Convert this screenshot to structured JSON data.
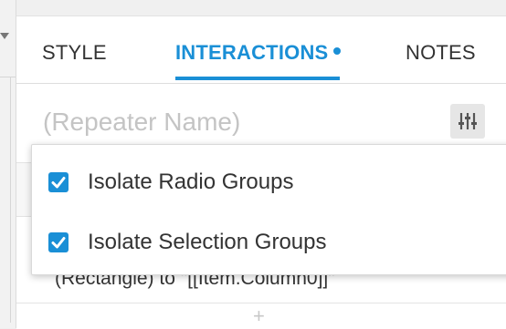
{
  "tabs": [
    {
      "label": "STYLE",
      "active": false
    },
    {
      "label": "INTERACTIONS",
      "active": true,
      "has_indicator": true
    },
    {
      "label": "NOTES",
      "active": false
    }
  ],
  "repeater_name": {
    "placeholder": "(Repeater Name)",
    "value": ""
  },
  "settings_icon": "sliders-icon",
  "partially_hidden_text": "(Rectangle) to \"[[Item.Column0]]\"",
  "add_icon": "plus-icon",
  "dropdown": {
    "options": [
      {
        "label": "Isolate Radio Groups",
        "checked": true
      },
      {
        "label": "Isolate Selection Groups",
        "checked": true
      }
    ]
  },
  "colors": {
    "accent": "#1a8fd6",
    "text": "#333333",
    "placeholder": "#c4c4c4"
  }
}
